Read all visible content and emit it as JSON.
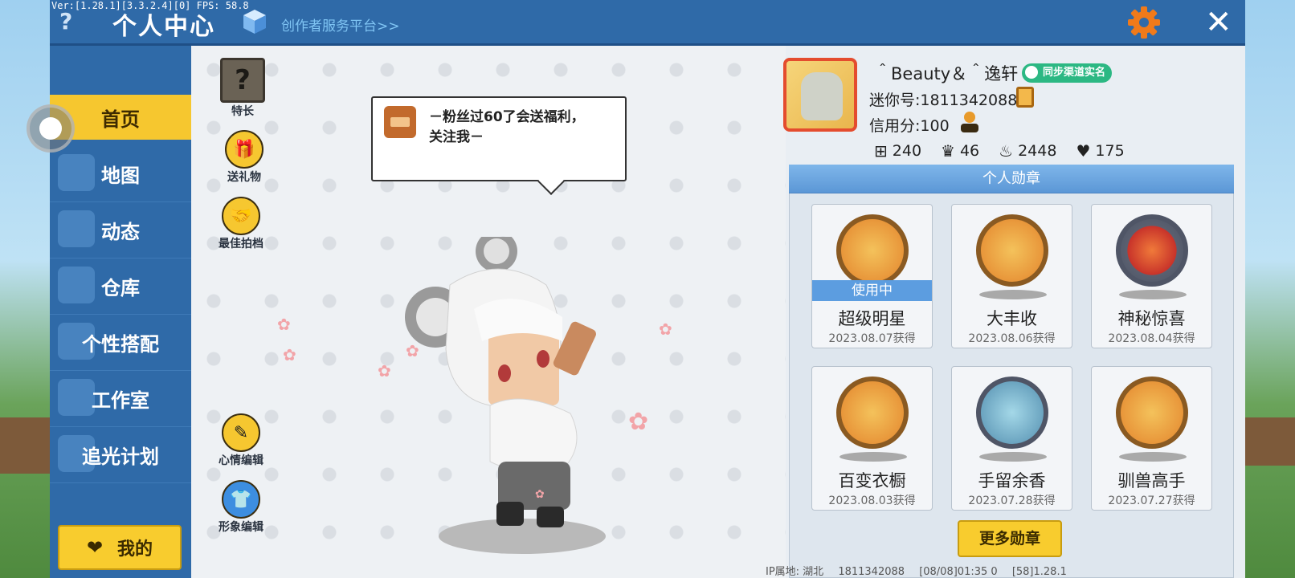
{
  "version_text": "Ver:[1.28.1][3.3.2.4][0] FPS: 58.8",
  "header": {
    "help_label": "?",
    "title": "个人中心",
    "creator_link": "创作者服务平台>>",
    "close_label": "✕"
  },
  "sidebar": {
    "items": [
      {
        "label": "首页",
        "icon": "home-icon",
        "active": true
      },
      {
        "label": "地图",
        "icon": "map-icon"
      },
      {
        "label": "动态",
        "icon": "bell-icon"
      },
      {
        "label": "仓库",
        "icon": "warehouse-icon"
      },
      {
        "label": "个性搭配",
        "icon": "outfit-icon"
      },
      {
        "label": "工作室",
        "icon": "studio-icon"
      },
      {
        "label": "追光计划",
        "icon": "light-plan-icon"
      }
    ],
    "mine_label": "我的"
  },
  "tools": {
    "specialty": "特长",
    "gift": "送礼物",
    "partner": "最佳拍档",
    "mood_edit": "心情编辑",
    "avatar_edit": "形象编辑"
  },
  "bubble": {
    "text_line1": "－粉丝过60了会送福利，",
    "text_line2": "关注我－"
  },
  "profile": {
    "name": "＾Beauty＆＾逸轩",
    "sync_badge": "同步渠道实名",
    "mini_id": "迷你号:1811342088",
    "credit": "信用分:100",
    "stats": [
      {
        "icon": "plus-icon",
        "value": "240"
      },
      {
        "icon": "fans-icon",
        "value": "46"
      },
      {
        "icon": "fire-icon",
        "value": "2448"
      },
      {
        "icon": "heart-icon",
        "value": "175"
      }
    ]
  },
  "medals": {
    "title": "个人勋章",
    "in_use_label": "使用中",
    "items": [
      {
        "name": "超级明星",
        "date": "2023.08.07获得",
        "in_use": true
      },
      {
        "name": "大丰收",
        "date": "2023.08.06获得"
      },
      {
        "name": "神秘惊喜",
        "date": "2023.08.04获得"
      },
      {
        "name": "百变衣橱",
        "date": "2023.08.03获得"
      },
      {
        "name": "手留余香",
        "date": "2023.07.28获得"
      },
      {
        "name": "驯兽高手",
        "date": "2023.07.27获得"
      }
    ],
    "more_label": "更多勋章"
  },
  "footer": {
    "ip": "IP属地: 湖北",
    "uid": "1811342088",
    "time": "[08/08]01:35 0",
    "build": "[58]1.28.1"
  },
  "colors": {
    "primary_blue": "#2f6aa8",
    "accent_yellow": "#f6c72f",
    "gear_orange": "#f07a1a"
  }
}
